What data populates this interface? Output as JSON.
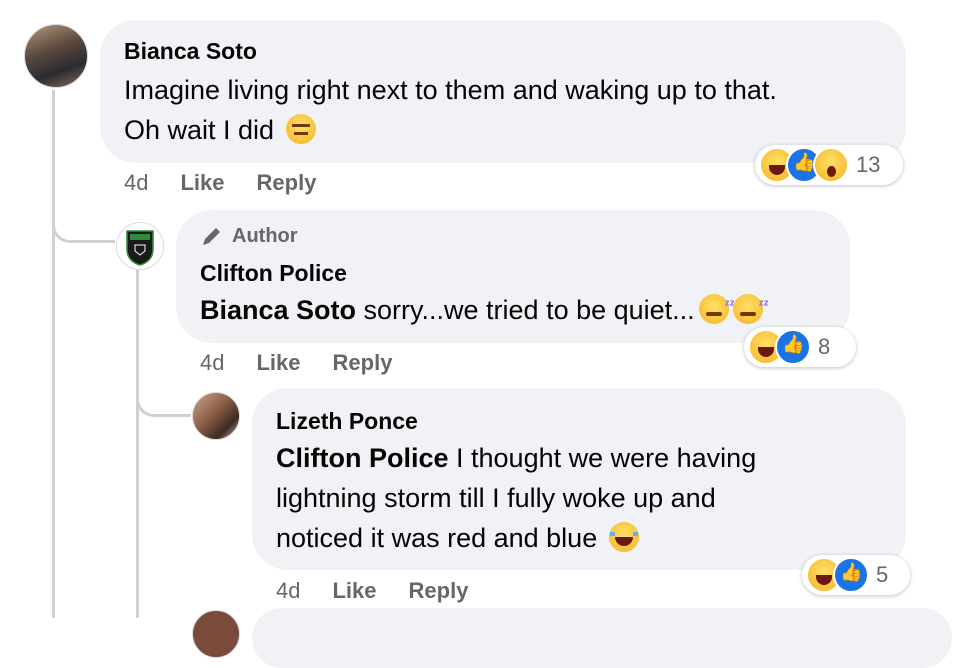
{
  "comments": [
    {
      "author": "Bianca Soto",
      "line1": "Imagine living right next to them and waking up to that.",
      "line2": "Oh wait I did",
      "time": "4d",
      "like": "Like",
      "reply": "Reply",
      "reaction_count": "13",
      "reactions": [
        "haha",
        "like",
        "wow"
      ]
    },
    {
      "badge": "Author",
      "author": "Clifton Police",
      "mention": "Bianca Soto",
      "text": " sorry...we tried to be quiet...",
      "time": "4d",
      "like": "Like",
      "reply": "Reply",
      "reaction_count": "8",
      "reactions": [
        "haha",
        "like"
      ]
    },
    {
      "author": "Lizeth Ponce",
      "mention": "Clifton Police",
      "line1": " I thought we were having",
      "line2": "lightning storm till I fully woke up and",
      "line3": "noticed it was red and blue",
      "time": "4d",
      "like": "Like",
      "reply": "Reply",
      "reaction_count": "5",
      "reactions": [
        "haha",
        "like"
      ]
    }
  ],
  "colors": {
    "bubble": "#f0f2f5",
    "meta": "#65676b",
    "like_blue": "#1b74e4",
    "line": "#ced0d4"
  }
}
